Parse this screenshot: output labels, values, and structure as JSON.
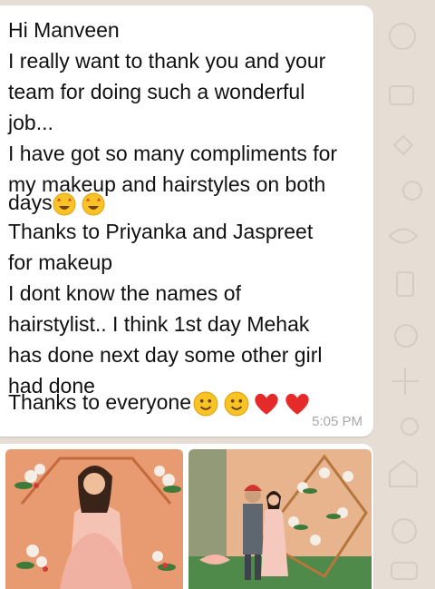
{
  "message": {
    "lines": [
      "Hi Manveen",
      "I really want to thank you and your",
      "team for doing such a wonderful",
      "job...",
      "I have got so many compliments for",
      "my makeup and hairstyles on both",
      "days",
      "Thanks to Priyanka and Jaspreet",
      "for makeup",
      "I dont know the names of",
      "hairstylist.. I think 1st day Mehak",
      "has done next day some other girl",
      "had done",
      "Thanks to everyone"
    ],
    "time": "5:05 PM",
    "emojis": {
      "days_line": [
        "star-struck-face-emoji",
        "star-struck-face-emoji"
      ],
      "last_line": [
        "smiling-face-emoji",
        "smiling-face-emoji",
        "red-heart-emoji",
        "red-heart-emoji"
      ]
    }
  },
  "photos": [
    {
      "name": "bride-photo-flower-backdrop"
    },
    {
      "name": "couple-photo-flower-backdrop"
    }
  ],
  "colors": {
    "wallpaper": "#e6ddd4",
    "bubble": "#ffffff",
    "text": "#111111",
    "time": "#a9a9a9"
  }
}
